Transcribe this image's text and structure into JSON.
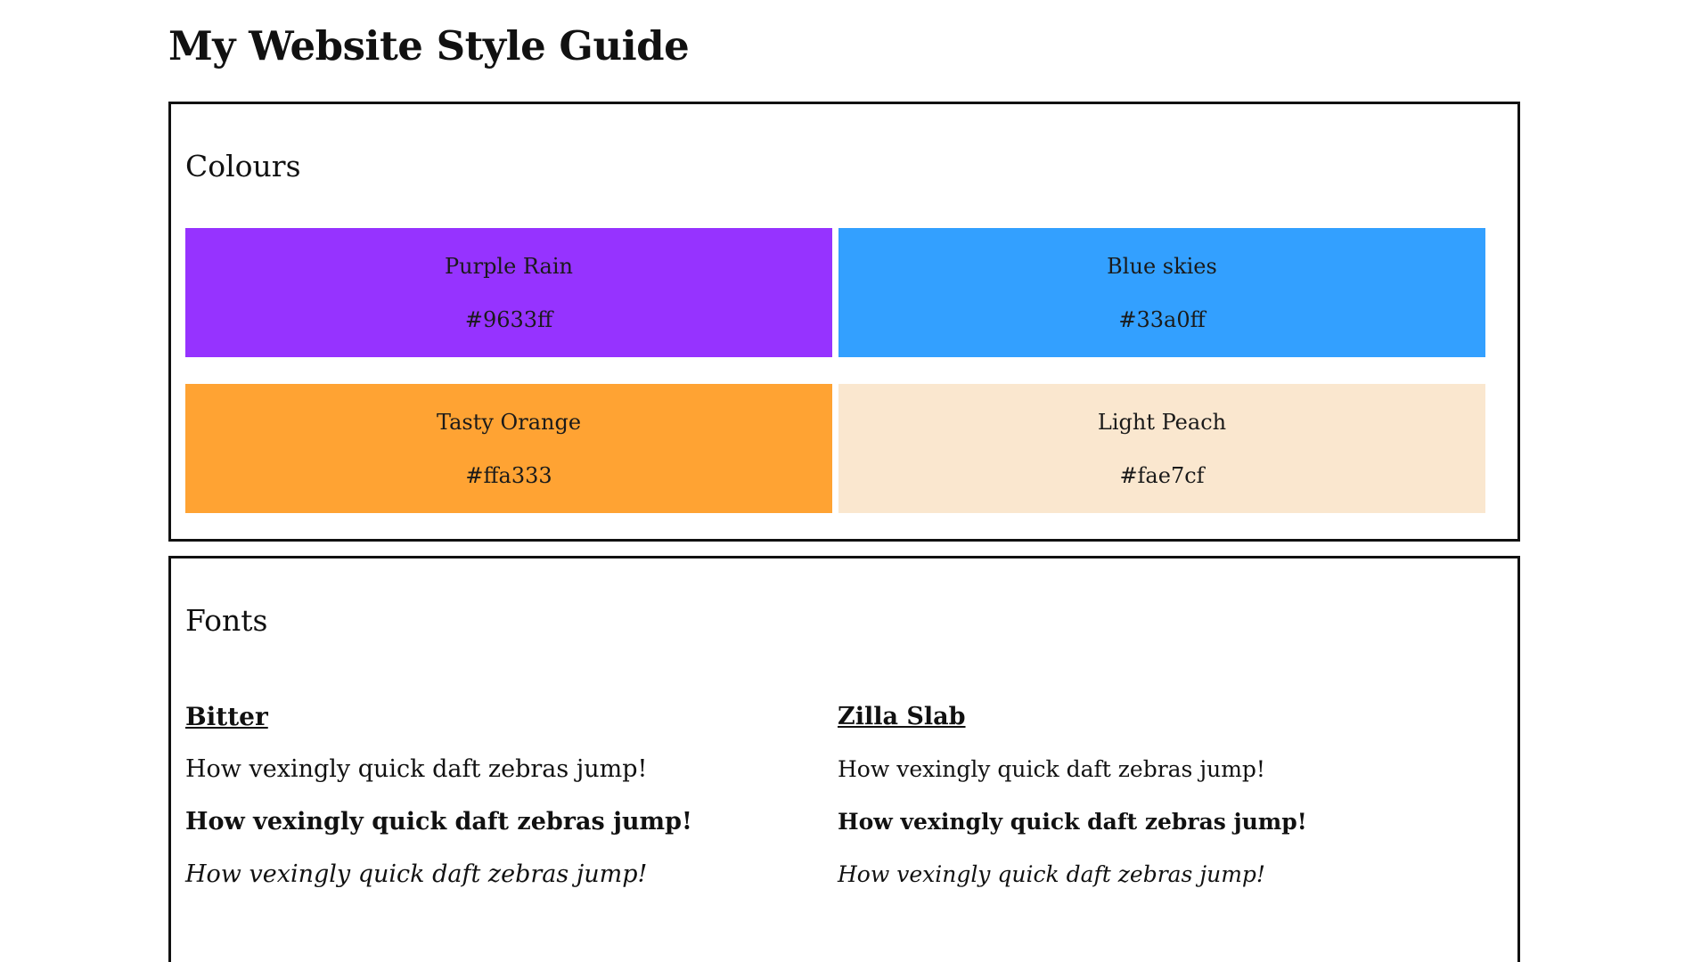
{
  "page": {
    "title": "My Website Style Guide"
  },
  "colours": {
    "heading": "Colours",
    "swatches": [
      {
        "name": "Purple Rain",
        "hex": "#9633ff",
        "color": "#9633ff"
      },
      {
        "name": "Blue skies",
        "hex": "#33a0ff",
        "color": "#33a0ff"
      },
      {
        "name": "Tasty Orange",
        "hex": "#ffa333",
        "color": "#ffa333"
      },
      {
        "name": "Light Peach",
        "hex": "#fae7cf",
        "color": "#fae7cf"
      }
    ]
  },
  "fonts": {
    "heading": "Fonts",
    "families": [
      {
        "name": "Bitter",
        "samples": {
          "regular": "How vexingly quick daft zebras jump!",
          "bold": "How vexingly quick daft zebras jump!",
          "italic": "How vexingly quick daft zebras jump!"
        }
      },
      {
        "name": "Zilla Slab",
        "samples": {
          "regular": "How vexingly quick daft zebras jump!",
          "bold": "How vexingly quick daft zebras jump!",
          "italic": "How vexingly quick daft zebras jump!"
        }
      }
    ]
  }
}
